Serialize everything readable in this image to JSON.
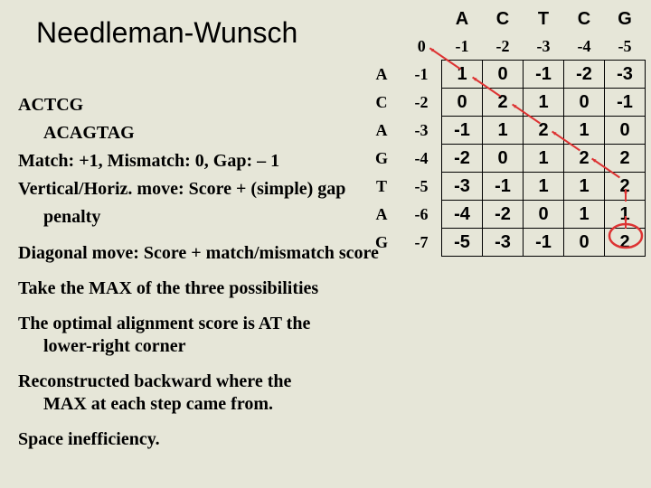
{
  "title": "Needleman-Wunsch",
  "seq1_line": "ACTCG",
  "seq2_line": "ACAGTAG",
  "scoring_line": "Match: +1, Mismatch: 0, Gap: – 1",
  "vert_move_line1": "Vertical/Horiz. move:  Score + (simple) gap",
  "vert_move_line2": "penalty",
  "diag_move_line": "Diagonal move:  Score + match/mismatch score",
  "take_max_line": "Take the MAX of the three possibilities",
  "optimal_line1": "The optimal alignment score is AT the",
  "optimal_line2": "lower-right corner",
  "recon_line1": "Reconstructed backward where the",
  "recon_line2": "MAX at each step came from.",
  "space_line": "Space inefficiency.",
  "matrix": {
    "col_headers": [
      "A",
      "C",
      "T",
      "C",
      "G"
    ],
    "row_headers": [
      "A",
      "C",
      "A",
      "G",
      "T",
      "A",
      "G"
    ],
    "top_init": [
      "0",
      "-1",
      "-2",
      "-3",
      "-4",
      "-5"
    ],
    "left_init": [
      "-1",
      "-2",
      "-3",
      "-4",
      "-5",
      "-6",
      "-7"
    ],
    "cells": [
      [
        "1",
        "0",
        "-1",
        "-2",
        "-3"
      ],
      [
        "0",
        "2",
        "1",
        "0",
        "-1"
      ],
      [
        "-1",
        "1",
        "2",
        "1",
        "0"
      ],
      [
        "-2",
        "0",
        "1",
        "2",
        "2"
      ],
      [
        "-3",
        "-1",
        "1",
        "1",
        "2"
      ],
      [
        "-4",
        "-2",
        "0",
        "1",
        "1"
      ],
      [
        "-5",
        "-3",
        "-1",
        "0",
        "2"
      ]
    ]
  },
  "chart_data": {
    "type": "table",
    "description": "Needleman-Wunsch dynamic programming matrix",
    "seq_top": "ACTCG",
    "seq_left": "ACAGTAG",
    "gap": -1,
    "match": 1,
    "mismatch": 0,
    "dp": [
      [
        0,
        -1,
        -2,
        -3,
        -4,
        -5
      ],
      [
        -1,
        1,
        0,
        -1,
        -2,
        -3
      ],
      [
        -2,
        0,
        2,
        1,
        0,
        -1
      ],
      [
        -3,
        -1,
        1,
        2,
        1,
        0
      ],
      [
        -4,
        -2,
        0,
        1,
        2,
        2
      ],
      [
        -5,
        -3,
        -1,
        1,
        1,
        2
      ],
      [
        -6,
        -4,
        -2,
        0,
        1,
        1
      ],
      [
        -7,
        -5,
        -3,
        -1,
        0,
        2
      ]
    ],
    "traceback_path_cells": [
      [
        1,
        1
      ],
      [
        2,
        2
      ],
      [
        3,
        3
      ],
      [
        4,
        4
      ],
      [
        5,
        5
      ],
      [
        6,
        5
      ],
      [
        7,
        5
      ]
    ],
    "optimal_score": 2
  }
}
